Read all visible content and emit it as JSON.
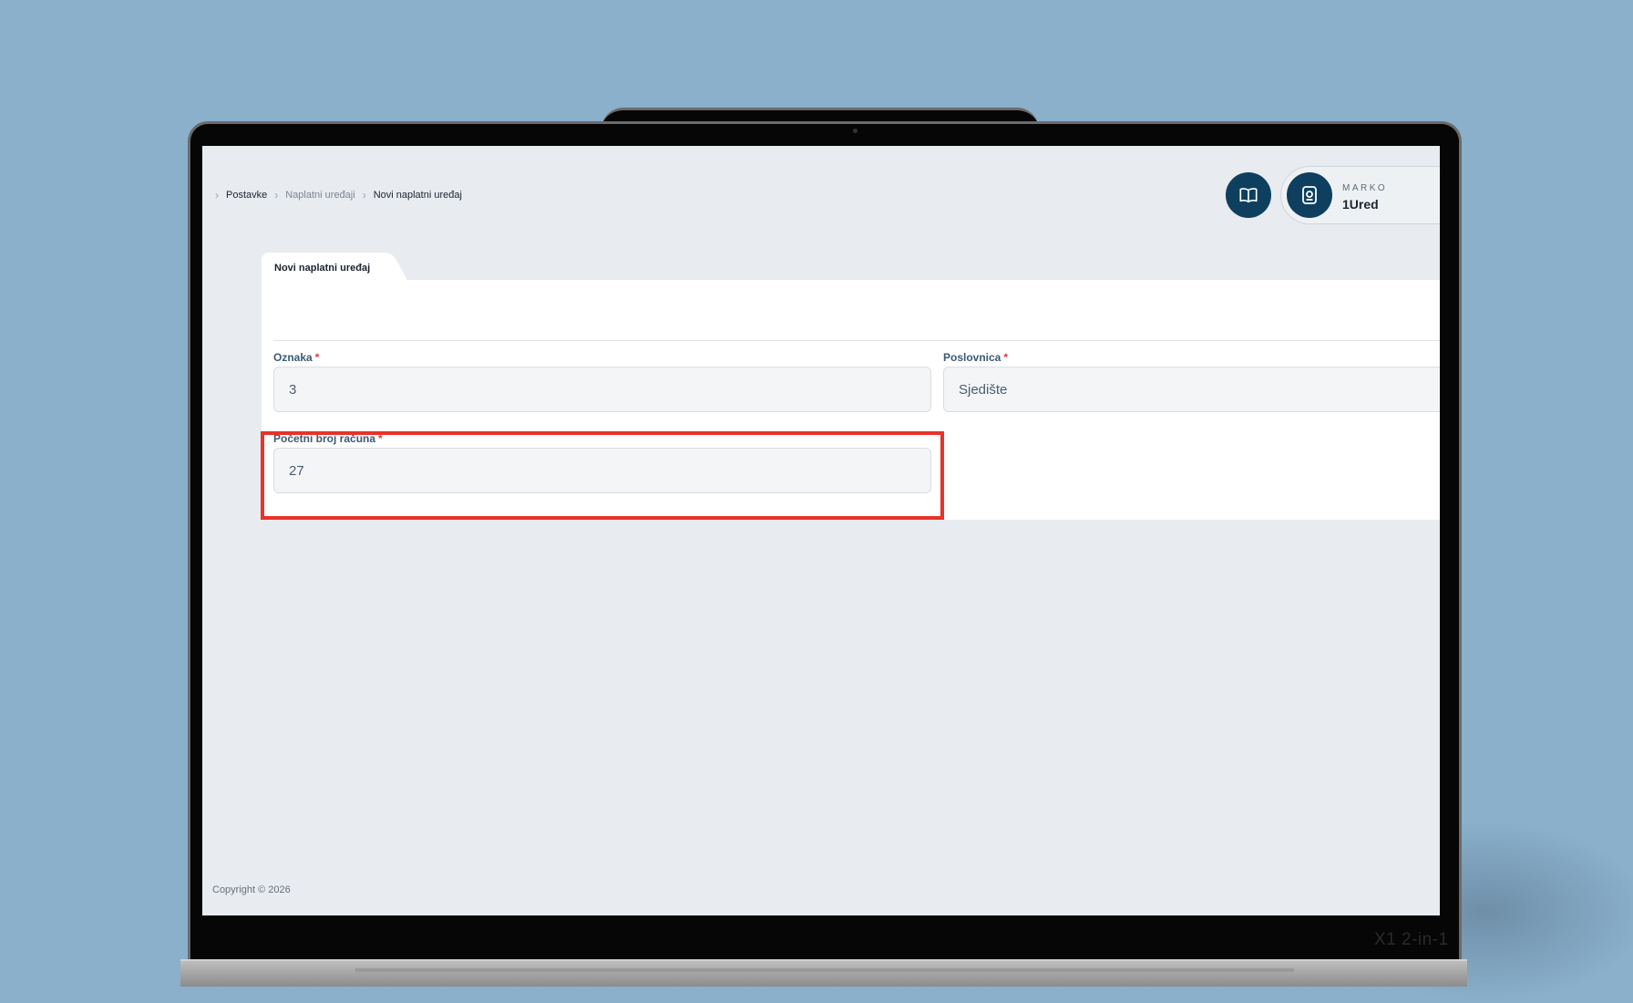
{
  "breadcrumb": {
    "items": [
      "Postavke",
      "Naplatni uređaji",
      "Novi naplatni uređaj"
    ]
  },
  "header": {
    "docs_icon": "book-open-icon",
    "user_icon": "id-badge-icon",
    "user_role": "MARKO",
    "user_org": "1Ured"
  },
  "form": {
    "tab_label": "Novi naplatni uređaj",
    "oznaka": {
      "label": "Oznaka",
      "required": "*",
      "value": "3"
    },
    "poslovnica": {
      "label": "Poslovnica",
      "required": "*",
      "value": "Sjedište"
    },
    "pocetni_broj": {
      "label": "Početni broj računa",
      "required": "*",
      "value": "27"
    }
  },
  "footer": {
    "copyright": "Copyright © 2026"
  },
  "device": {
    "model": "X1 2-in-1"
  },
  "colors": {
    "accent": "#0e3f5e",
    "background": "#8ab0cc",
    "highlight": "#e8322a",
    "required": "#e23b3b"
  }
}
